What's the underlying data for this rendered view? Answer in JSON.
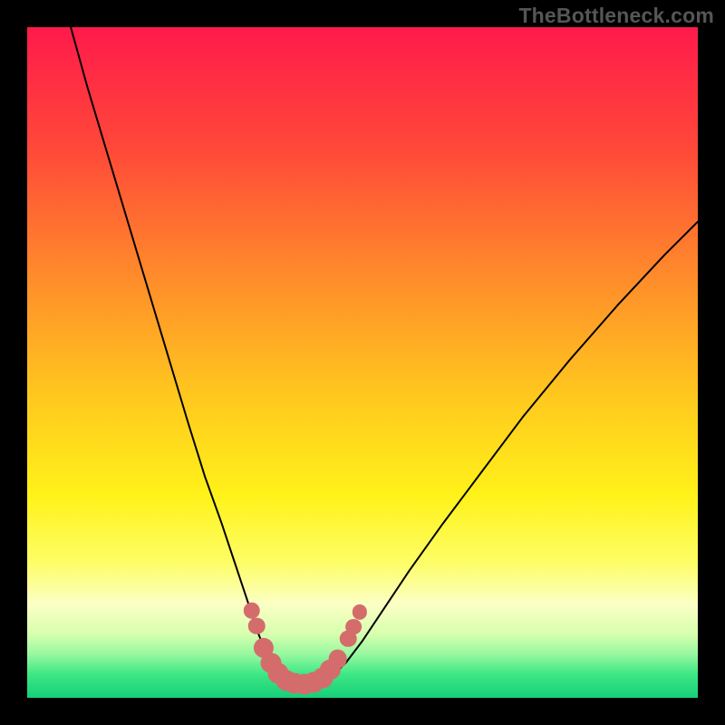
{
  "watermark": {
    "text": "TheBottleneck.com"
  },
  "chart_data": {
    "type": "line",
    "title": "",
    "xlabel": "",
    "ylabel": "",
    "xlim": [
      0,
      100
    ],
    "ylim": [
      0,
      100
    ],
    "grid": false,
    "legend": false,
    "background_gradient_stops": [
      {
        "pos": 0.0,
        "color": "#ff1a4b"
      },
      {
        "pos": 0.18,
        "color": "#ff4839"
      },
      {
        "pos": 0.38,
        "color": "#ff8e2a"
      },
      {
        "pos": 0.55,
        "color": "#ffc81e"
      },
      {
        "pos": 0.7,
        "color": "#fff21a"
      },
      {
        "pos": 0.8,
        "color": "#fdfe68"
      },
      {
        "pos": 0.86,
        "color": "#fcffc5"
      },
      {
        "pos": 0.905,
        "color": "#d7ffae"
      },
      {
        "pos": 0.935,
        "color": "#97f8a0"
      },
      {
        "pos": 0.965,
        "color": "#3de784"
      },
      {
        "pos": 1.0,
        "color": "#17cf79"
      }
    ],
    "series": [
      {
        "name": "left-branch",
        "x": [
          6.5,
          9,
          12,
          15,
          18,
          21,
          24,
          26.5,
          29,
          31,
          33,
          34.5,
          35.8,
          36.8,
          37.5
        ],
        "y": [
          100,
          91,
          81,
          71,
          61,
          51,
          41,
          33,
          26,
          20,
          14,
          9.5,
          6.3,
          4.2,
          3.0
        ]
      },
      {
        "name": "trough",
        "x": [
          37.5,
          38.5,
          39.5,
          40.5,
          41.5,
          42.5,
          43.5,
          44.5,
          45.5
        ],
        "y": [
          3.0,
          2.2,
          1.8,
          1.65,
          1.6,
          1.7,
          2.0,
          2.5,
          3.3
        ]
      },
      {
        "name": "right-branch",
        "x": [
          45.5,
          47.5,
          50,
          53,
          57,
          62,
          68,
          74,
          81,
          88,
          95,
          100
        ],
        "y": [
          3.3,
          5.2,
          8.5,
          13,
          19,
          26,
          34,
          42,
          50.5,
          58.5,
          66,
          71
        ]
      }
    ],
    "beads": {
      "color": "#d46c6c",
      "points": [
        {
          "x": 33.5,
          "y": 13.0,
          "r": 1.25
        },
        {
          "x": 34.2,
          "y": 10.7,
          "r": 1.25
        },
        {
          "x": 35.3,
          "y": 7.5,
          "r": 1.5
        },
        {
          "x": 36.3,
          "y": 5.2,
          "r": 1.55
        },
        {
          "x": 37.4,
          "y": 3.6,
          "r": 1.55
        },
        {
          "x": 38.6,
          "y": 2.6,
          "r": 1.55
        },
        {
          "x": 39.9,
          "y": 2.1,
          "r": 1.55
        },
        {
          "x": 41.3,
          "y": 2.05,
          "r": 1.55
        },
        {
          "x": 42.7,
          "y": 2.3,
          "r": 1.55
        },
        {
          "x": 44.0,
          "y": 3.0,
          "r": 1.55
        },
        {
          "x": 45.2,
          "y": 4.2,
          "r": 1.5
        },
        {
          "x": 46.3,
          "y": 5.8,
          "r": 1.4
        },
        {
          "x": 47.9,
          "y": 8.8,
          "r": 1.25
        },
        {
          "x": 48.7,
          "y": 10.6,
          "r": 1.2
        },
        {
          "x": 49.6,
          "y": 12.8,
          "r": 1.1
        }
      ]
    }
  }
}
